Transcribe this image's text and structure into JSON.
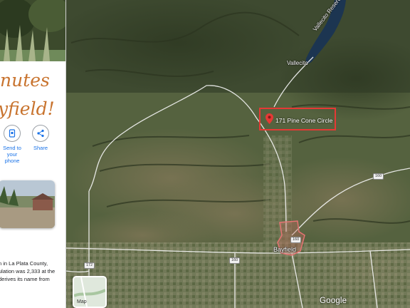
{
  "map": {
    "reservoir_label": "Vallecito Reservoir",
    "town_labels": {
      "vallecito": "Vallecito",
      "bayfield": "Bayfield"
    },
    "marker_label": "171 Pine Cone Circle",
    "route_shields": [
      "160",
      "160",
      "172",
      "160"
    ],
    "attribution": "Google",
    "map_type_label": "Map",
    "colors": {
      "terrain": "#55623f",
      "water": "#1c3551",
      "roads": "#f5f5f5",
      "marker": "#e53935",
      "town": "#e57373"
    }
  },
  "panel": {
    "headline_line1": "nutes",
    "headline_line2": "yfield!",
    "send_phone_label_1": "Send to your",
    "send_phone_label_2": "phone",
    "share_label": "Share",
    "body_line1": "n in La Plata County,",
    "body_line2": "ulation was 2,333 at the",
    "body_line3": "derives its name from"
  }
}
